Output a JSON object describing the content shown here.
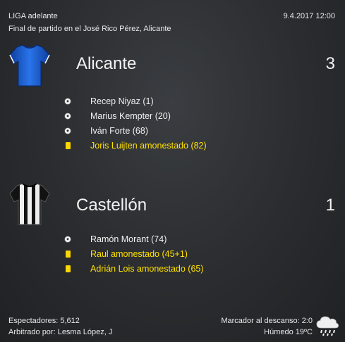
{
  "header": {
    "competition": "LIGA adelante",
    "match_info": "Final de partido en el José Rico Pérez, Alicante",
    "datetime": "9.4.2017 12:00"
  },
  "home": {
    "name": "Alicante",
    "score": "3",
    "shirt_color": "#1e63d6",
    "shirt_icon": "blue-shirt-icon",
    "events": [
      {
        "type": "goal",
        "icon": "soccer-ball-icon",
        "text": "Recep Niyaz (1)"
      },
      {
        "type": "goal",
        "icon": "soccer-ball-icon",
        "text": "Marius Kempter (20)"
      },
      {
        "type": "goal",
        "icon": "soccer-ball-icon",
        "text": "Iván Forte (68)"
      },
      {
        "type": "card",
        "icon": "yellow-card-icon",
        "text": "Joris Luijten amonestado (82)"
      }
    ]
  },
  "away": {
    "name": "Castellón",
    "score": "1",
    "shirt_color": "#111111",
    "shirt_icon": "black-white-striped-shirt-icon",
    "events": [
      {
        "type": "goal",
        "icon": "soccer-ball-icon",
        "text": "Ramón Morant (74)"
      },
      {
        "type": "card",
        "icon": "yellow-card-icon",
        "text": "Raul amonestado (45+1)"
      },
      {
        "type": "card",
        "icon": "yellow-card-icon",
        "text": "Adrián Lois amonestado (65)"
      }
    ]
  },
  "footer": {
    "attendance": "Espectadores: 5,612",
    "referee": "Arbitrado por: Lesma López, J",
    "halftime": "Marcador al descanso: 2:0",
    "weather": "Húmedo 19ºC",
    "weather_icon": "rain-cloud-icon"
  },
  "colors": {
    "background": "#2a2c2f",
    "card_text": "#ffe000",
    "yellow_card": "#ffd600"
  }
}
